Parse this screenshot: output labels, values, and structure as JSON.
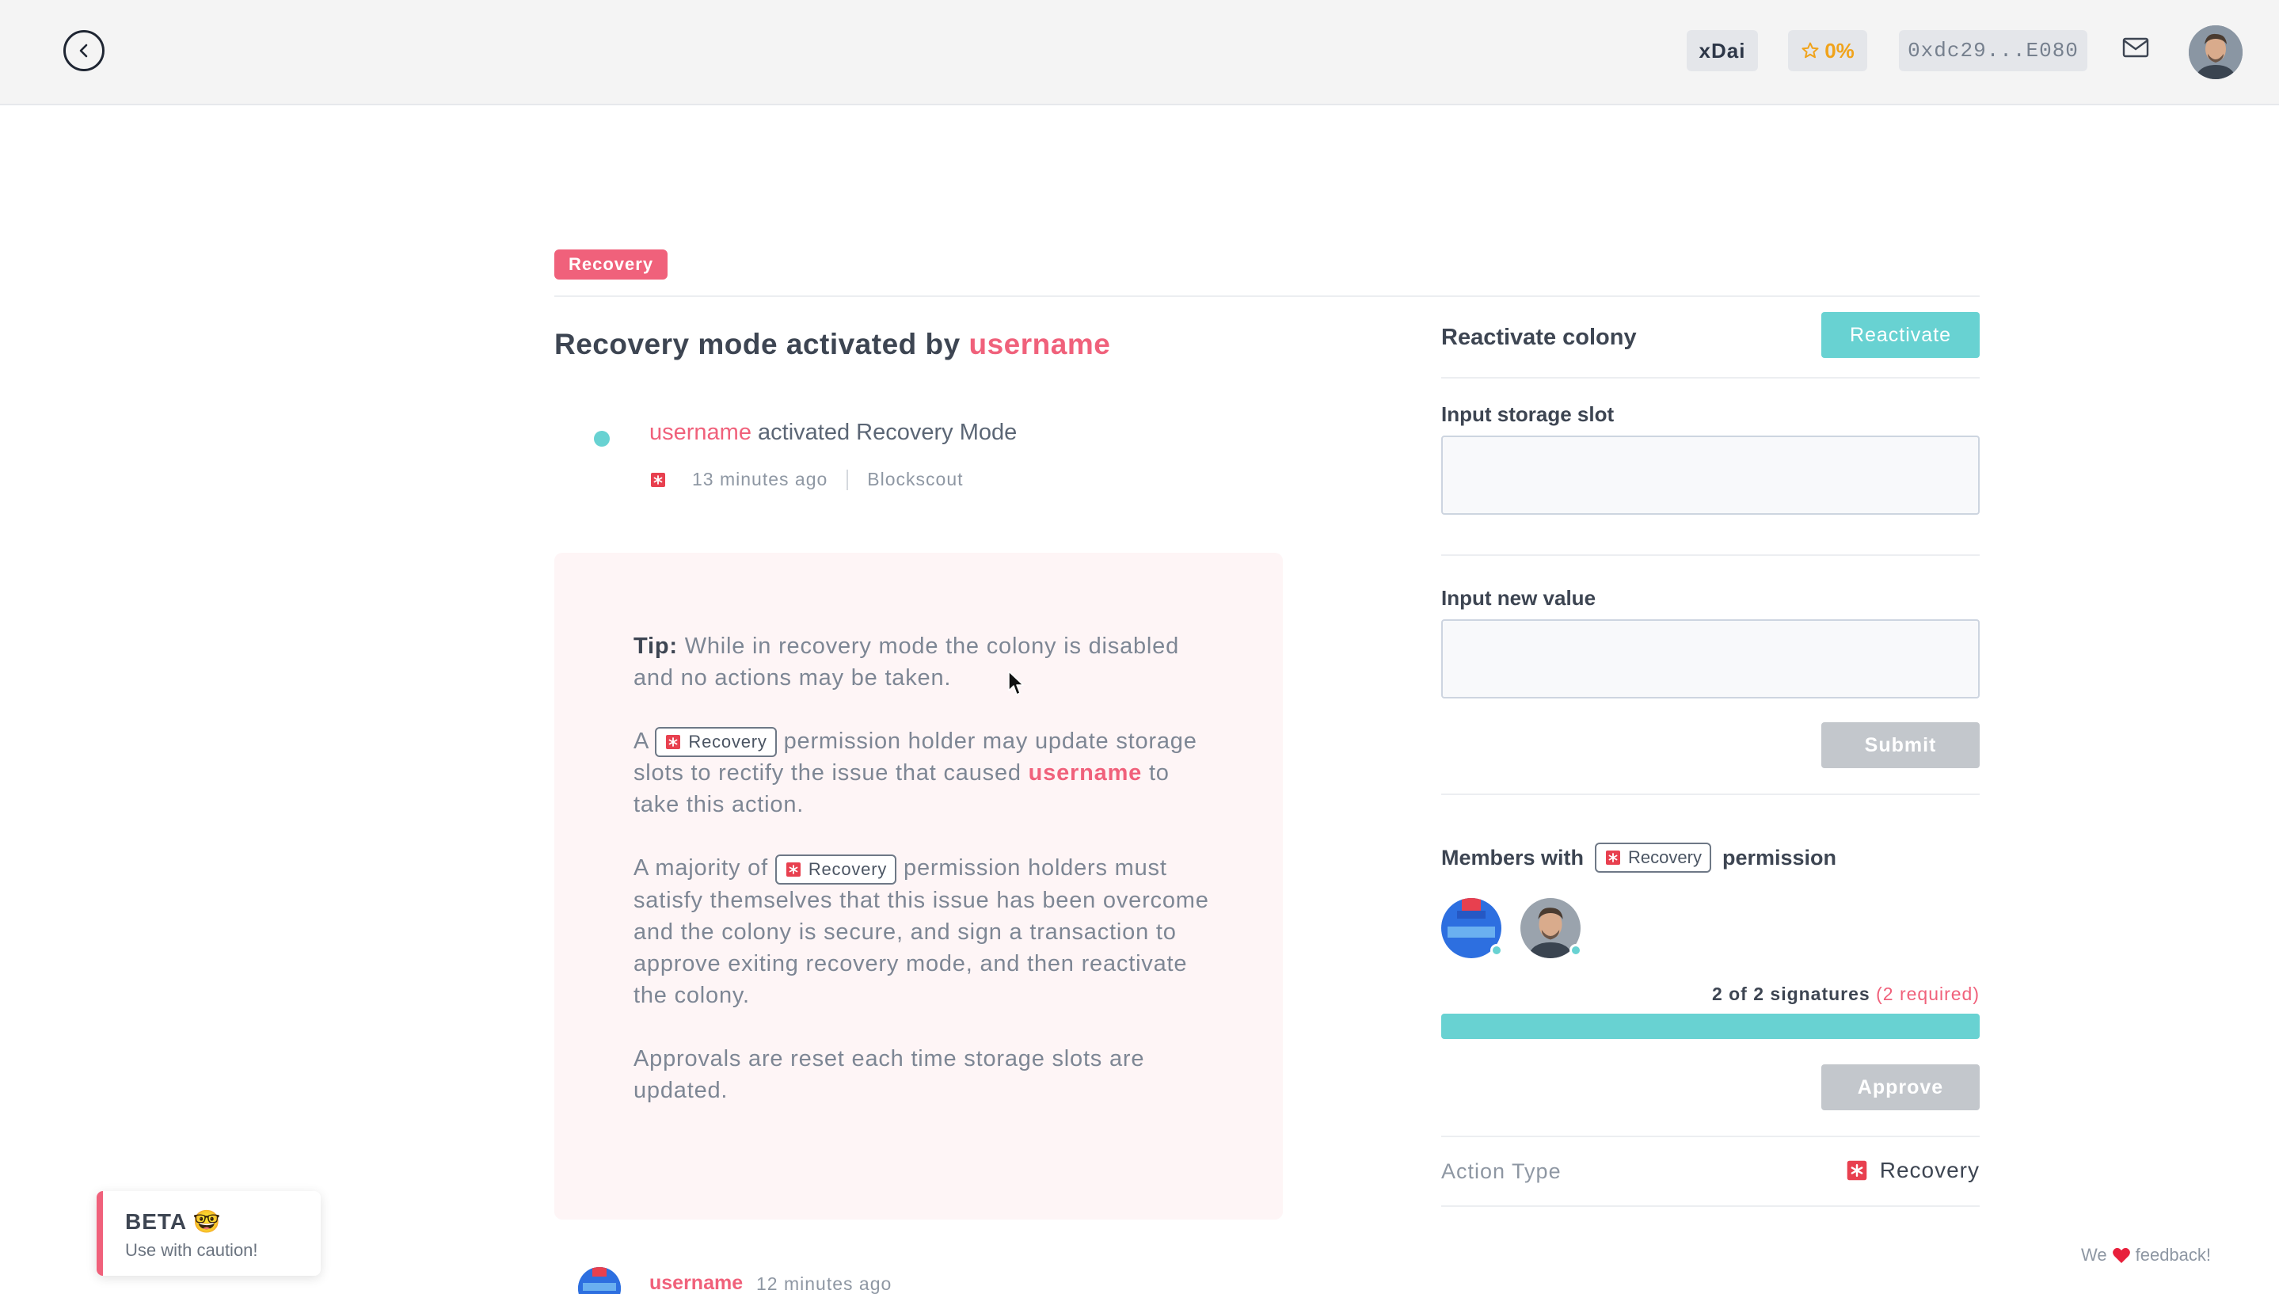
{
  "header": {
    "network": "xDai",
    "reputation": "0%",
    "wallet_address": "0xdc29...E080",
    "icons": {
      "back": "chevron-left-icon",
      "star": "star-icon",
      "inbox": "envelope-icon"
    }
  },
  "action": {
    "badge": "Recovery",
    "title_prefix": "Recovery mode activated by",
    "title_user": "username"
  },
  "event": {
    "user": "username",
    "text": "activated Recovery Mode",
    "time": "13 minutes ago",
    "explorer": "Blockscout"
  },
  "tip": {
    "label": "Tip:",
    "p1": "While in recovery mode the colony is disabled and no actions may be taken.",
    "p2_a": "A",
    "p2_chip": "Recovery",
    "p2_b": "permission holder may update storage slots to rectify the issue that caused",
    "p2_user": "username",
    "p2_c": "to take this action.",
    "p3_a": "A majority of",
    "p3_chip": "Recovery",
    "p3_b": "permission holders must satisfy themselves that this issue has been overcome and the colony is secure, and sign a transaction to approve exiting recovery mode, and then reactivate the colony.",
    "p4": "Approvals are reset each time storage slots are updated."
  },
  "comment": {
    "user": "username",
    "time": "12 minutes ago"
  },
  "sidebar": {
    "reactivate_label": "Reactivate colony",
    "reactivate_button": "Reactivate",
    "storage_slot_label": "Input storage slot",
    "storage_slot_value": "",
    "new_value_label": "Input new value",
    "new_value_value": "",
    "submit_button": "Submit",
    "members_prefix": "Members with",
    "members_chip": "Recovery",
    "members_suffix": "permission",
    "signatures_text": "2 of 2 signatures",
    "signatures_required": "(2 required)",
    "signatures_progress": 1.0,
    "approve_button": "Approve",
    "action_type_label": "Action Type",
    "action_type_value": "Recovery"
  },
  "beta": {
    "title": "BETA 🤓",
    "subtitle": "Use with caution!"
  },
  "feedback": {
    "prefix": "We",
    "suffix": "feedback!"
  },
  "colors": {
    "accent_pink": "#f0617b",
    "accent_teal": "#68d2d2",
    "disabled_gray": "#c3c7cc"
  }
}
